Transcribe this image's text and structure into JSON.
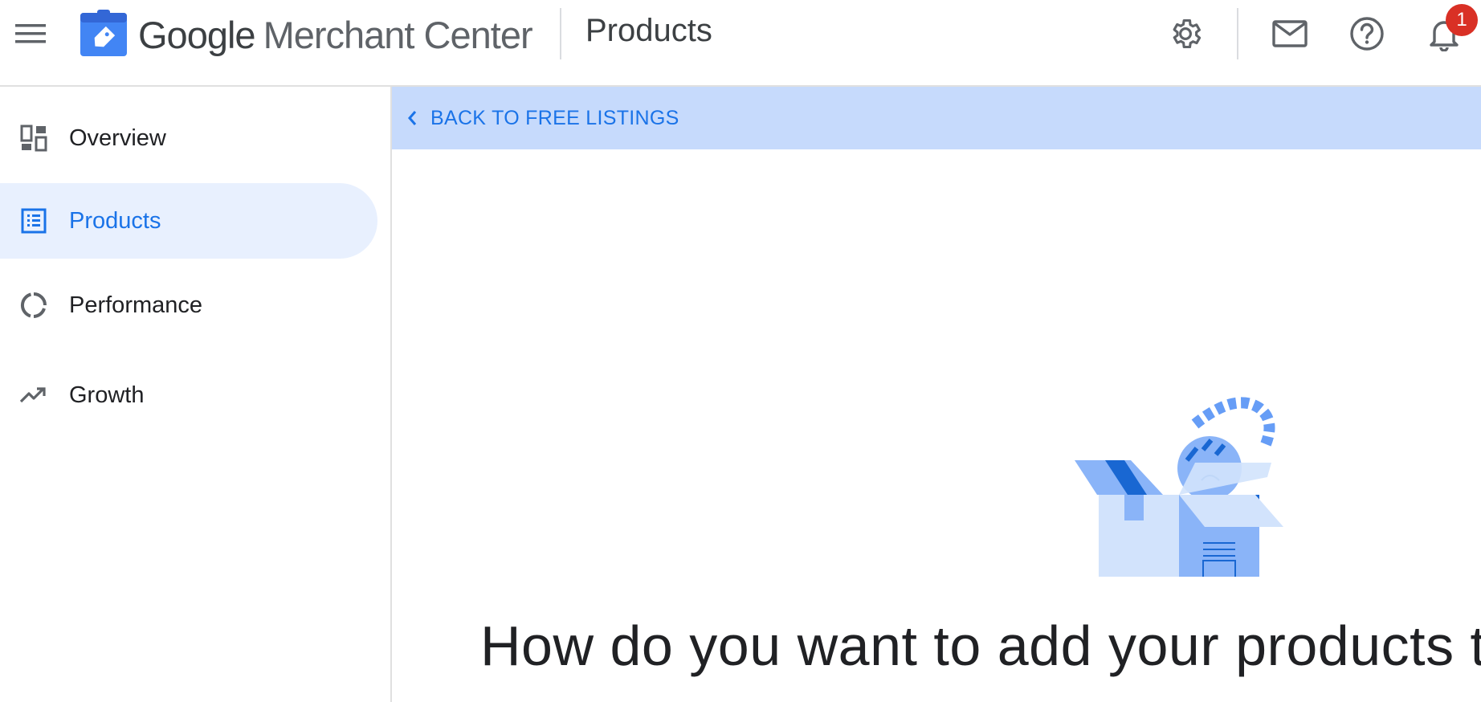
{
  "header": {
    "brand_google": "Google",
    "brand_product": "Merchant Center",
    "page_name": "Products",
    "notification_count": "1",
    "icons": [
      "menu-icon",
      "settings-icon",
      "mail-icon",
      "help-icon",
      "bell-icon"
    ]
  },
  "sidebar": {
    "items": [
      {
        "label": "Overview",
        "icon": "overview-icon",
        "active": false
      },
      {
        "label": "Products",
        "icon": "products-icon",
        "active": true
      },
      {
        "label": "Performance",
        "icon": "performance-icon",
        "active": false
      },
      {
        "label": "Growth",
        "icon": "growth-icon",
        "active": false
      }
    ]
  },
  "main": {
    "back_label": "BACK TO FREE LISTINGS",
    "headline": "How do you want to add your products to"
  },
  "colors": {
    "accent": "#1a73e8",
    "backbar": "#c6dafc",
    "active_nav": "#e8f0fe",
    "badge": "#d93025"
  }
}
